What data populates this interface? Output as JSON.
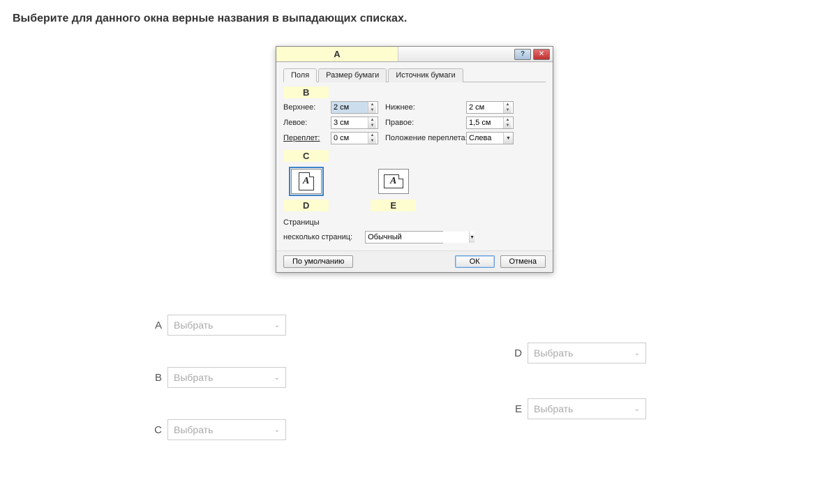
{
  "instruction": "Выберите для данного окна верные названия в выпадающих списках.",
  "markers": {
    "A": "A",
    "B": "B",
    "C": "C",
    "D": "D",
    "E": "E"
  },
  "titlebar": {
    "help": "?",
    "close": "✕"
  },
  "tabs": {
    "t1": "Поля",
    "t2": "Размер бумаги",
    "t3": "Источник бумаги"
  },
  "fields": {
    "top_label": "Верхнее:",
    "top_value": "2 см",
    "bottom_label": "Нижнее:",
    "bottom_value": "2 см",
    "left_label": "Левое:",
    "left_value": "3 см",
    "right_label": "Правое:",
    "right_value": "1,5 см",
    "gutter_label": "Переплет:",
    "gutter_value": "0 см",
    "gutter_pos_label": "Положение переплета:",
    "gutter_pos_value": "Слева"
  },
  "orientation": {
    "portrait_glyph": "A",
    "landscape_glyph": "A"
  },
  "pages": {
    "section_label": "Страницы",
    "multi_label": "несколько страниц:",
    "multi_value": "Обычный"
  },
  "buttons": {
    "default": "По умолчанию",
    "ok": "ОК",
    "cancel": "Отмена"
  },
  "answers": {
    "placeholder": "Выбрать",
    "A": "A",
    "B": "B",
    "C": "C",
    "D": "D",
    "E": "E"
  }
}
